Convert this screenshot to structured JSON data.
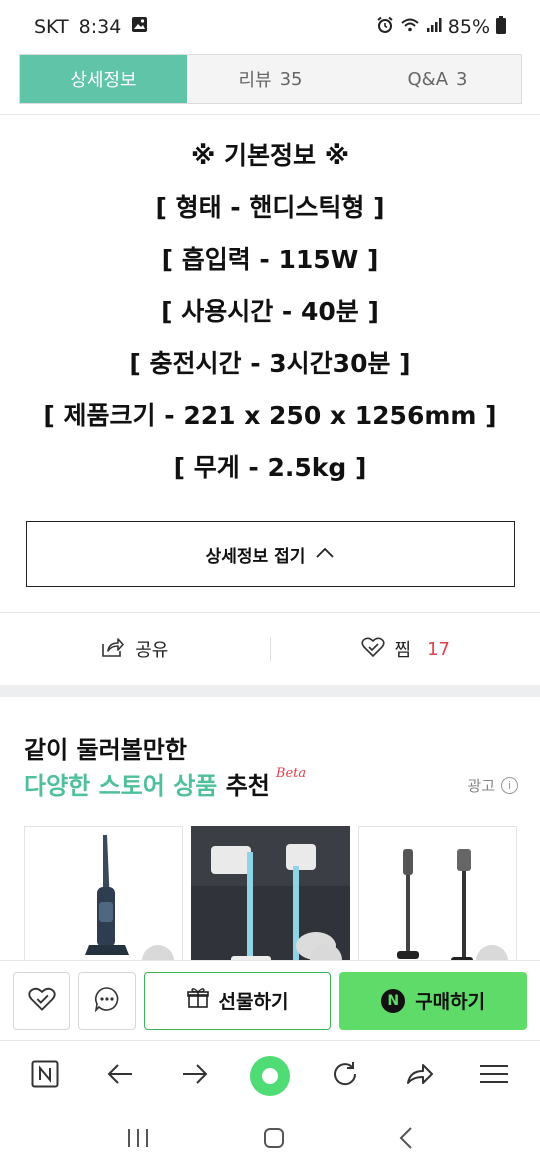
{
  "status_bar": {
    "carrier": "SKT",
    "time": "8:34",
    "battery": "85%"
  },
  "tabs": [
    {
      "label": "상세정보",
      "count": ""
    },
    {
      "label": "리뷰",
      "count": "35"
    },
    {
      "label": "Q&A",
      "count": "3"
    }
  ],
  "info_lines": [
    "※ 기본정보 ※",
    "[ 형태 - 핸디스틱형 ]",
    "[ 흡입력 - 115W ]",
    "[ 사용시간 - 40분 ]",
    "[ 충전시간 - 3시간30분 ]",
    "[ 제품크기 - 221 x 250 x 1256mm ]",
    "[ 무게 - 2.5kg ]"
  ],
  "collapse_label": "상세정보 접기",
  "share_label": "공유",
  "zzim_label": "찜",
  "zzim_count": "17",
  "recommend": {
    "title_line1": "같이 둘러볼만한",
    "title_green": "다양한 스토어 상품",
    "title_rest": "추천",
    "beta": "Beta",
    "ad_label": "광고"
  },
  "bottom": {
    "gift_label": "선물하기",
    "buy_label": "구매하기",
    "buy_badge": "N"
  },
  "colors": {
    "accent_teal": "#5fc4a8",
    "buy_green": "#5fdb6a",
    "heart_red": "#e2424a"
  }
}
